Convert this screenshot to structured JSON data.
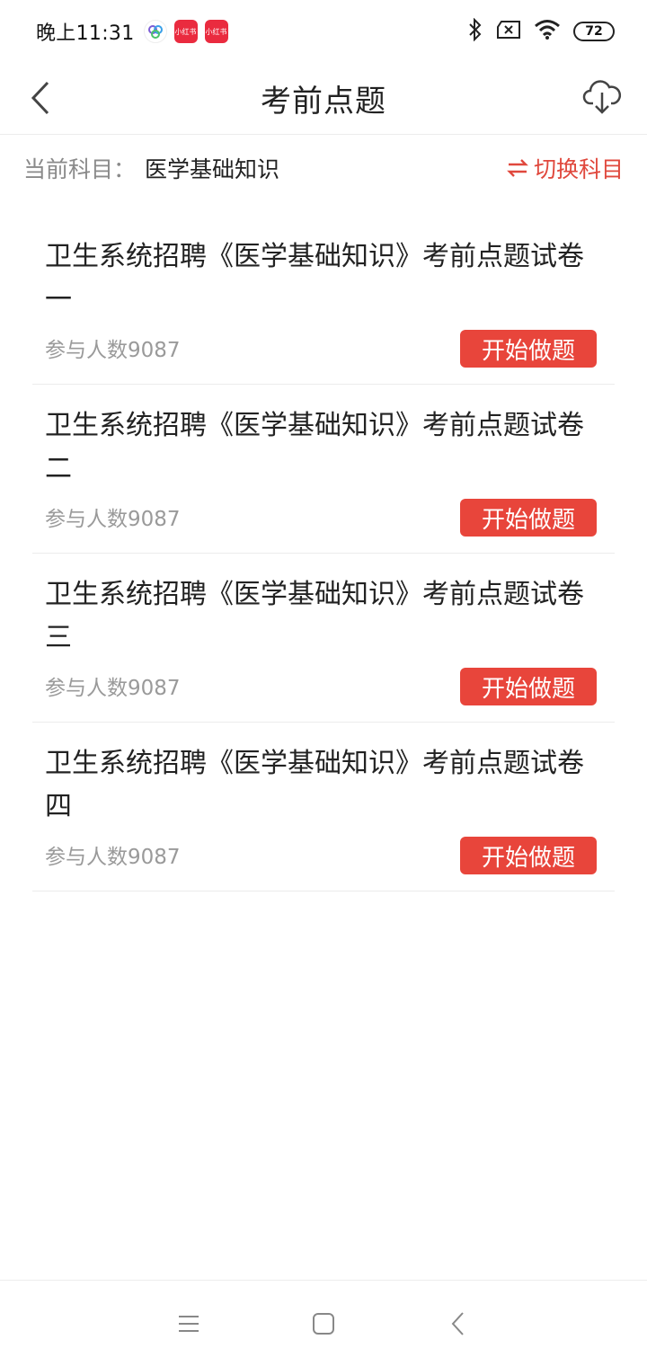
{
  "status_bar": {
    "time": "晚上11:31",
    "app_badges": [
      "小红书",
      "小红书"
    ],
    "battery": "72"
  },
  "header": {
    "title": "考前点题"
  },
  "subject": {
    "label": "当前科目：",
    "value": "医学基础知识",
    "switch_label": "切换科目"
  },
  "papers": [
    {
      "title": "卫生系统招聘《医学基础知识》考前点题试卷一",
      "count": "参与人数9087",
      "button": "开始做题"
    },
    {
      "title": "卫生系统招聘《医学基础知识》考前点题试卷二",
      "count": "参与人数9087",
      "button": "开始做题"
    },
    {
      "title": "卫生系统招聘《医学基础知识》考前点题试卷三",
      "count": "参与人数9087",
      "button": "开始做题"
    },
    {
      "title": "卫生系统招聘《医学基础知识》考前点题试卷四",
      "count": "参与人数9087",
      "button": "开始做题"
    }
  ],
  "colors": {
    "accent": "#e8453b",
    "muted_text": "#9a9a9a"
  }
}
